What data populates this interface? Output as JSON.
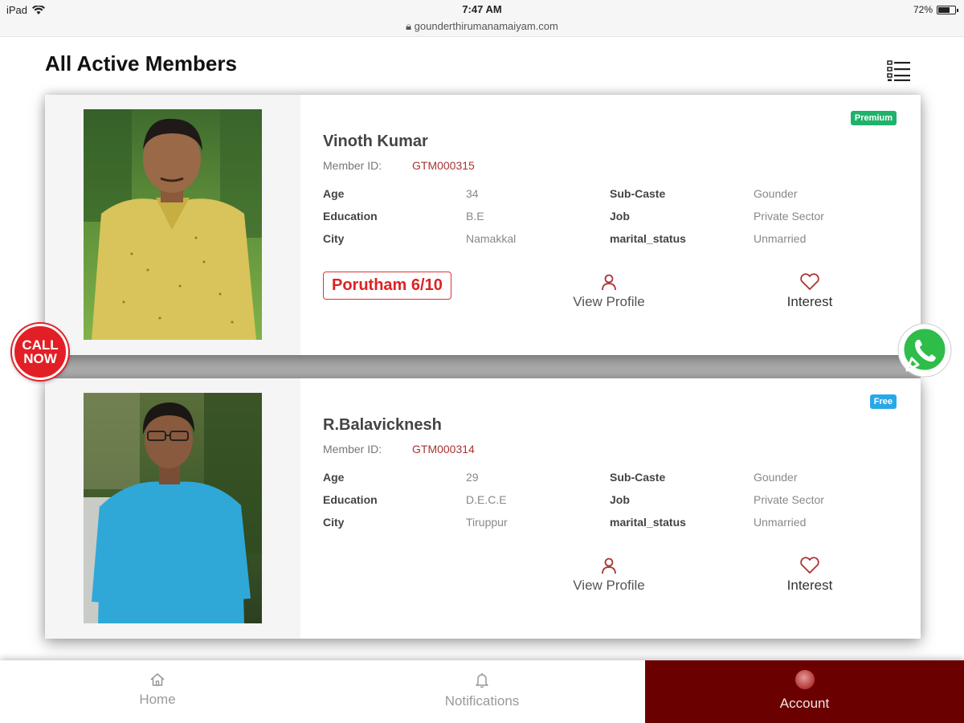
{
  "statusbar": {
    "device": "iPad",
    "time": "7:47 AM",
    "url": "gounderthirumanamaiyam.com",
    "battery": "72%",
    "battery_level": 0.72
  },
  "header": {
    "title": "All Active Members"
  },
  "labels": {
    "member_id": "Member ID:",
    "age": "Age",
    "education": "Education",
    "city": "City",
    "subcaste": "Sub-Caste",
    "job": "Job",
    "marital": "marital_status",
    "view_profile": "View Profile",
    "interest": "Interest"
  },
  "members": [
    {
      "name": "Vinoth Kumar",
      "member_id": "GTM000315",
      "badge": "Premium",
      "age": "34",
      "education": "B.E",
      "city": "Namakkal",
      "subcaste": "Gounder",
      "job": "Private Sector",
      "marital": "Unmarried",
      "porutham": "Porutham 6/10"
    },
    {
      "name": "R.Balavicknesh",
      "member_id": "GTM000314",
      "badge": "Free",
      "age": "29",
      "education": "D.E.C.E",
      "city": "Tiruppur",
      "subcaste": "Gounder",
      "job": "Private Sector",
      "marital": "Unmarried"
    }
  ],
  "call_now": {
    "line1": "CALL",
    "line2": "NOW"
  },
  "bottom_nav": {
    "home": "Home",
    "notifications": "Notifications",
    "account": "Account"
  },
  "colors": {
    "accent": "#6b0000",
    "premium": "#20b26b",
    "free": "#29a8e8",
    "porutham": "#d22222"
  }
}
